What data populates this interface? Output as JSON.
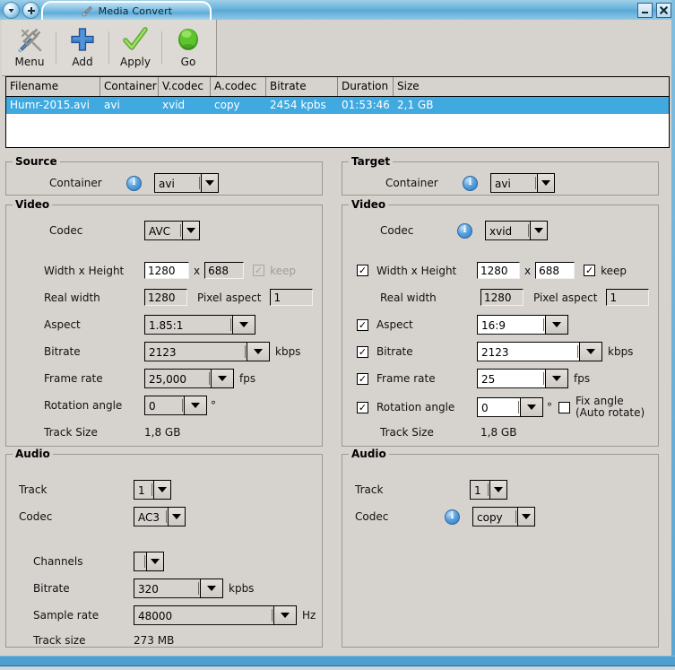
{
  "window": {
    "tab_title": "Media Convert",
    "tab_icon": "wrench-icon",
    "menu_arrow_icon": "chevron-down-icon",
    "add_tab_icon": "plus-icon",
    "minimize_label": "_",
    "close_label": "✕"
  },
  "toolbar": {
    "items": [
      {
        "label": "Menu",
        "icon": "tools-icon"
      },
      {
        "label": "Add",
        "icon": "plus-icon"
      },
      {
        "label": "Apply",
        "icon": "checkmark-icon"
      },
      {
        "label": "Go",
        "icon": "green-orb-icon"
      }
    ]
  },
  "filelist": {
    "columns": [
      "Filename",
      "Container",
      "V.codec",
      "A.codec",
      "Bitrate",
      "Duration",
      "Size"
    ],
    "rows": [
      {
        "filename": "Humr-2015.avi",
        "container": "avi",
        "vcodec": "xvid",
        "acodec": "copy",
        "bitrate": "2454 kpbs",
        "duration": "01:53:46",
        "size": "2,1 GB",
        "selected": true
      }
    ],
    "selection_color": "#3fa9e0"
  },
  "source": {
    "group_label": "Source",
    "container_label": "Container",
    "container_value": "avi",
    "video": {
      "group_label": "Video",
      "codec_label": "Codec",
      "codec_value": "AVC",
      "wh_label": "Width x Height",
      "width_value": "1280",
      "x_sep": "x",
      "height_value": "688",
      "keep_label": "keep",
      "keep_checked": true,
      "realwidth_label": "Real width",
      "realwidth_value": "1280",
      "pixelaspect_label": "Pixel aspect",
      "pixelaspect_value": "1",
      "aspect_label": "Aspect",
      "aspect_value": "1.85:1",
      "bitrate_label": "Bitrate",
      "bitrate_value": "2123",
      "bitrate_unit": "kbps",
      "framerate_label": "Frame rate",
      "framerate_value": "25,000",
      "framerate_unit": "fps",
      "rotation_label": "Rotation angle",
      "rotation_value": "0",
      "rotation_unit": "°",
      "tracksize_label": "Track Size",
      "tracksize_value": "1,8 GB"
    },
    "audio": {
      "group_label": "Audio",
      "track_label": "Track",
      "track_value": "1",
      "codec_label": "Codec",
      "codec_value": "AC3",
      "channels_label": "Channels",
      "channels_value": "",
      "bitrate_label": "Bitrate",
      "bitrate_value": "320",
      "bitrate_unit": "kpbs",
      "samplerate_label": "Sample rate",
      "samplerate_value": "48000",
      "samplerate_unit": "Hz",
      "tracksize_label": "Track size",
      "tracksize_value": "273 MB"
    }
  },
  "target": {
    "group_label": "Target",
    "container_label": "Container",
    "container_value": "avi",
    "video": {
      "group_label": "Video",
      "codec_label": "Codec",
      "codec_value": "xvid",
      "wh_label": "Width x Height",
      "wh_checked": true,
      "width_value": "1280",
      "x_sep": "x",
      "height_value": "688",
      "keep_label": "keep",
      "keep_checked": true,
      "realwidth_label": "Real width",
      "realwidth_value": "1280",
      "pixelaspect_label": "Pixel aspect",
      "pixelaspect_value": "1",
      "aspect_label": "Aspect",
      "aspect_checked": true,
      "aspect_value": "16:9",
      "bitrate_label": "Bitrate",
      "bitrate_checked": true,
      "bitrate_value": "2123",
      "bitrate_unit": "kbps",
      "framerate_label": "Frame rate",
      "framerate_checked": true,
      "framerate_value": "25",
      "framerate_unit": "fps",
      "rotation_label": "Rotation angle",
      "rotation_checked": true,
      "rotation_value": "0",
      "rotation_unit": "°",
      "fixangle_label_1": "Fix angle",
      "fixangle_label_2": "(Auto rotate)",
      "fixangle_checked": false,
      "tracksize_label": "Track Size",
      "tracksize_value": "1,8 GB"
    },
    "audio": {
      "group_label": "Audio",
      "track_label": "Track",
      "track_value": "1",
      "codec_label": "Codec",
      "codec_value": "copy"
    }
  },
  "colors": {
    "window_bg": "#d6d2cd",
    "titlebar_blue": "#5aa9d6",
    "selection_blue": "#3fa9e0",
    "info_blue": "#2f78c0"
  }
}
